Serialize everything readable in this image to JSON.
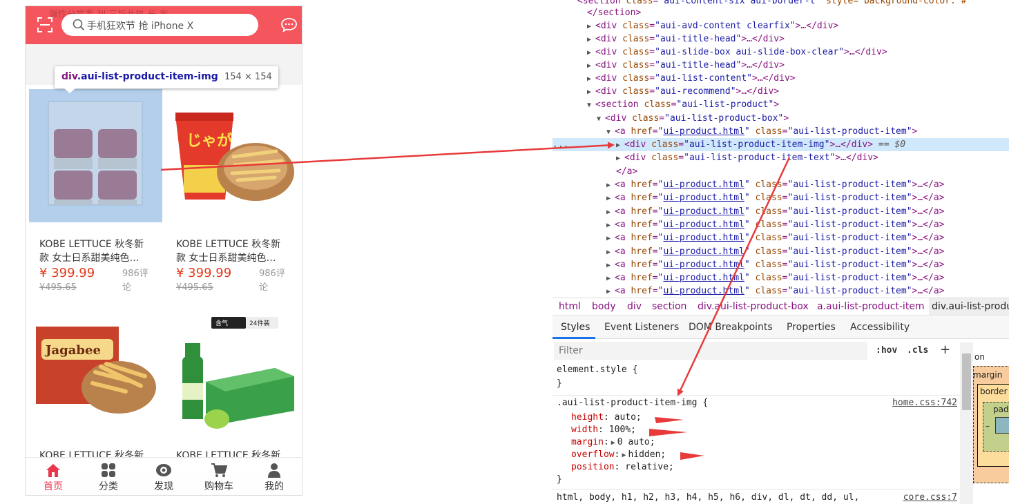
{
  "phone": {
    "ghost_text": "弹性分学素 利 三折此热 长 发",
    "search_placeholder": "手机狂欢节 抢 iPhone X",
    "tooltip": {
      "tag": "div",
      "class": ".aui-list-product-item-img",
      "size": "154 × 154"
    },
    "products": [
      {
        "title_line1": "KOBE LETTUCE 秋冬新",
        "title_line2": "款 女士日系甜美纯色…",
        "price": "¥ 399.99",
        "old_price": "¥495.65",
        "comments": "986评论"
      },
      {
        "title_line1": "KOBE LETTUCE 秋冬新",
        "title_line2": "款 女士日系甜美纯色…",
        "price": "¥ 399.99",
        "old_price": "¥495.65",
        "comments": "986评论"
      },
      {
        "title_line1": "KOBE LETTUCE 秋冬新",
        "title_line2": "",
        "price": "",
        "old_price": "",
        "comments": ""
      },
      {
        "title_line1": "KOBE LETTUCE 秋冬新",
        "title_line2": "",
        "price": "",
        "old_price": "",
        "comments": ""
      }
    ],
    "pack_badge": {
      "left": "含气",
      "right": "24件装"
    },
    "tabbar": [
      {
        "label": "首页",
        "icon": "home-icon",
        "active": true
      },
      {
        "label": "分类",
        "icon": "grid-icon",
        "active": false
      },
      {
        "label": "发现",
        "icon": "eye-icon",
        "active": false
      },
      {
        "label": "购物车",
        "icon": "cart-icon",
        "active": false
      },
      {
        "label": "我的",
        "icon": "user-icon",
        "active": false
      }
    ],
    "colors": {
      "header": "#f5555d",
      "price": "#e4391b",
      "tab_active": "#e9364d"
    }
  },
  "devtools": {
    "dom_lines": [
      {
        "tag": "section",
        "classattr": "aui-content-six aui-border-t",
        "extra": "style=\"background-color: #"
      },
      {
        "close": "</section>"
      },
      {
        "tag": "div",
        "classattr": "aui-avd-content clearfix"
      },
      {
        "tag": "div",
        "classattr": "aui-title-head"
      },
      {
        "tag": "div",
        "classattr": "aui-slide-box aui-slide-box-clear"
      },
      {
        "tag": "div",
        "classattr": "aui-title-head"
      },
      {
        "tag": "div",
        "classattr": "aui-list-content"
      },
      {
        "tag": "div",
        "classattr": "aui-recommend"
      },
      {
        "tag": "section",
        "classattr": "aui-list-product"
      },
      {
        "tag": "div",
        "classattr": "aui-list-product-box"
      },
      {
        "tag": "a",
        "href": "ui-product.html",
        "classattr": "aui-list-product-item"
      },
      {
        "tag": "div",
        "classattr": "aui-list-product-item-img",
        "selected_suffix": "== $0"
      },
      {
        "tag": "div",
        "classattr": "aui-list-product-item-text"
      },
      {
        "close": "</a>"
      },
      {
        "tag": "a",
        "href": "ui-product.html",
        "classattr": "aui-list-product-item"
      }
    ],
    "dots": "...",
    "collapsed_a_count": 9,
    "breadcrumbs": [
      "html",
      "body",
      "div",
      "section",
      "div.aui-list-product-box",
      "a.aui-list-product-item",
      "div.aui-list-produ"
    ],
    "tabs": [
      "Styles",
      "Event Listeners",
      "DOM Breakpoints",
      "Properties",
      "Accessibility"
    ],
    "filter_placeholder": "Filter",
    "hov": ":hov",
    "cls": ".cls",
    "plus": "+",
    "element_style": "element.style {",
    "close_brace": "}",
    "rule": {
      "selector": ".aui-list-product-item-img {",
      "source": "home.css:742",
      "props": [
        {
          "name": "height",
          "value": "auto;"
        },
        {
          "name": "width",
          "value": "100%;"
        },
        {
          "name": "margin",
          "value": "0 auto;",
          "expand": true
        },
        {
          "name": "overflow",
          "value": "hidden;",
          "expand": true
        },
        {
          "name": "position",
          "value": "relative;"
        }
      ]
    },
    "next_rule": {
      "selector": "html, body, h1, h2, h3, h4, h5, h6, div, dl, dt, dd, ul,",
      "source": "core.css:7"
    },
    "boxmodel": {
      "position": "on",
      "margin": "margin",
      "border": "border",
      "padding": "padd",
      "dash": "–"
    }
  }
}
